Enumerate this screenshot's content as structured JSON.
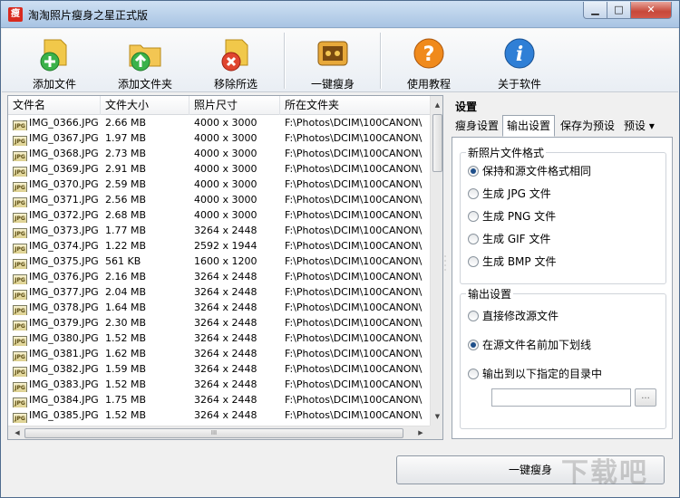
{
  "window": {
    "title": "淘淘照片瘦身之星正式版",
    "icon_text": "瘦"
  },
  "toolbar": [
    {
      "label": "添加文件",
      "icon": "add-file-icon"
    },
    {
      "label": "添加文件夹",
      "icon": "add-folder-icon"
    },
    {
      "label": "移除所选",
      "icon": "remove-selected-icon"
    },
    {
      "label": "一键瘦身",
      "icon": "one-click-slim-icon"
    },
    {
      "label": "使用教程",
      "icon": "help-icon"
    },
    {
      "label": "关于软件",
      "icon": "info-icon"
    }
  ],
  "file_list": {
    "columns": [
      "文件名",
      "文件大小",
      "照片尺寸",
      "所在文件夹"
    ],
    "rows": [
      [
        "IMG_0366.JPG",
        "2.66 MB",
        "4000 x 3000",
        "F:\\Photos\\DCIM\\100CANON\\"
      ],
      [
        "IMG_0367.JPG",
        "1.97 MB",
        "4000 x 3000",
        "F:\\Photos\\DCIM\\100CANON\\"
      ],
      [
        "IMG_0368.JPG",
        "2.73 MB",
        "4000 x 3000",
        "F:\\Photos\\DCIM\\100CANON\\"
      ],
      [
        "IMG_0369.JPG",
        "2.91 MB",
        "4000 x 3000",
        "F:\\Photos\\DCIM\\100CANON\\"
      ],
      [
        "IMG_0370.JPG",
        "2.59 MB",
        "4000 x 3000",
        "F:\\Photos\\DCIM\\100CANON\\"
      ],
      [
        "IMG_0371.JPG",
        "2.56 MB",
        "4000 x 3000",
        "F:\\Photos\\DCIM\\100CANON\\"
      ],
      [
        "IMG_0372.JPG",
        "2.68 MB",
        "4000 x 3000",
        "F:\\Photos\\DCIM\\100CANON\\"
      ],
      [
        "IMG_0373.JPG",
        "1.77 MB",
        "3264 x 2448",
        "F:\\Photos\\DCIM\\100CANON\\"
      ],
      [
        "IMG_0374.JPG",
        "1.22 MB",
        "2592 x 1944",
        "F:\\Photos\\DCIM\\100CANON\\"
      ],
      [
        "IMG_0375.JPG",
        "561 KB",
        "1600 x 1200",
        "F:\\Photos\\DCIM\\100CANON\\"
      ],
      [
        "IMG_0376.JPG",
        "2.16 MB",
        "3264 x 2448",
        "F:\\Photos\\DCIM\\100CANON\\"
      ],
      [
        "IMG_0377.JPG",
        "2.04 MB",
        "3264 x 2448",
        "F:\\Photos\\DCIM\\100CANON\\"
      ],
      [
        "IMG_0378.JPG",
        "1.64 MB",
        "3264 x 2448",
        "F:\\Photos\\DCIM\\100CANON\\"
      ],
      [
        "IMG_0379.JPG",
        "2.30 MB",
        "3264 x 2448",
        "F:\\Photos\\DCIM\\100CANON\\"
      ],
      [
        "IMG_0380.JPG",
        "1.52 MB",
        "3264 x 2448",
        "F:\\Photos\\DCIM\\100CANON\\"
      ],
      [
        "IMG_0381.JPG",
        "1.62 MB",
        "3264 x 2448",
        "F:\\Photos\\DCIM\\100CANON\\"
      ],
      [
        "IMG_0382.JPG",
        "1.59 MB",
        "3264 x 2448",
        "F:\\Photos\\DCIM\\100CANON\\"
      ],
      [
        "IMG_0383.JPG",
        "1.52 MB",
        "3264 x 2448",
        "F:\\Photos\\DCIM\\100CANON\\"
      ],
      [
        "IMG_0384.JPG",
        "1.75 MB",
        "3264 x 2448",
        "F:\\Photos\\DCIM\\100CANON\\"
      ],
      [
        "IMG_0385.JPG",
        "1.52 MB",
        "3264 x 2448",
        "F:\\Photos\\DCIM\\100CANON\\"
      ]
    ],
    "file_icon_text": "JPG",
    "hscroll_grip": "III"
  },
  "settings": {
    "title": "设置",
    "tabs": [
      "瘦身设置",
      "输出设置",
      "保存为预设",
      "预设 ▾"
    ],
    "active_tab": "输出设置",
    "format_group": {
      "title": "新照片文件格式",
      "options": [
        {
          "label": "保持和源文件格式相同",
          "selected": true
        },
        {
          "label": "生成 JPG 文件",
          "selected": false
        },
        {
          "label": "生成 PNG 文件",
          "selected": false
        },
        {
          "label": "生成 GIF 文件",
          "selected": false
        },
        {
          "label": "生成 BMP 文件",
          "selected": false
        }
      ]
    },
    "output_group": {
      "title": "输出设置",
      "options": [
        {
          "label": "直接修改源文件",
          "selected": false
        },
        {
          "label": "在源文件名前加下划线",
          "selected": true
        },
        {
          "label": "输出到以下指定的目录中",
          "selected": false
        }
      ],
      "dir_value": "",
      "browse_label": "..."
    }
  },
  "run_button": "一键瘦身",
  "watermark": "下载吧"
}
